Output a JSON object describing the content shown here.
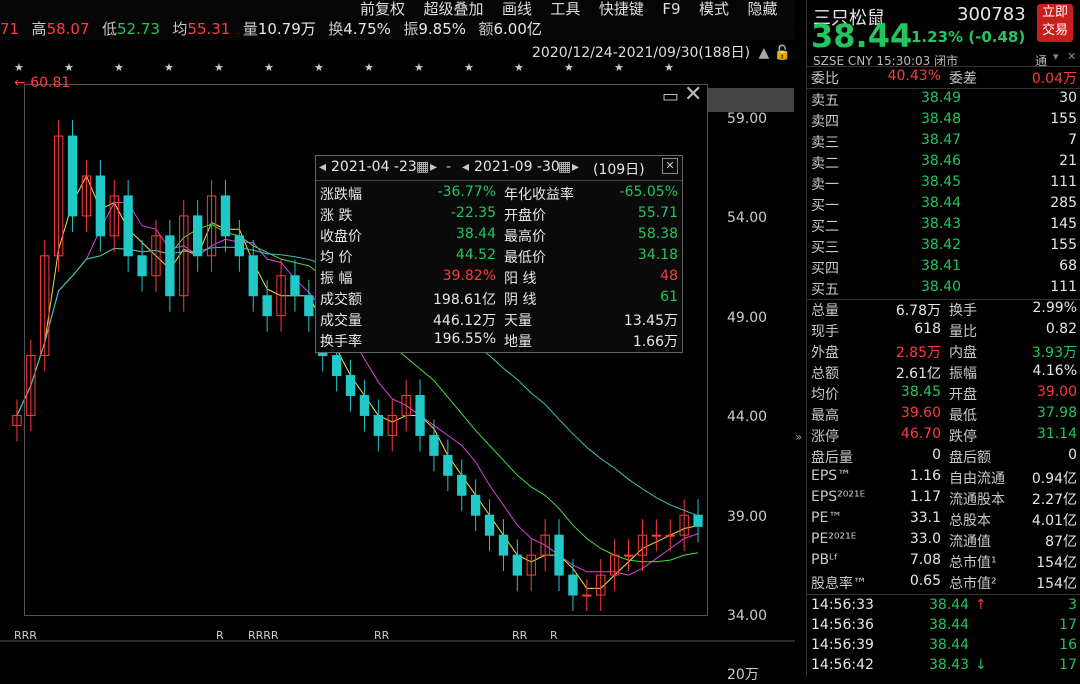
{
  "top": {
    "prev_close_partial": "71",
    "high_label": "高",
    "high": "58.07",
    "low_label": "低",
    "low": "52.73",
    "avg_label": "均",
    "avg": "55.31",
    "vol_label": "量",
    "vol": "10.79万",
    "turn_label": "换",
    "turn": "4.75%",
    "amp_label": "振",
    "amp": "9.85%",
    "amount_label": "额",
    "amount": "6.00亿",
    "menu": [
      "前复权",
      "超级叠加",
      "画线",
      "工具",
      "快捷键",
      "F9",
      "模式",
      "隐藏"
    ],
    "date_range": "2020/12/24-2021/09/30(188日)"
  },
  "chart": {
    "max_marker": "60.81",
    "yticks": [
      "59.00",
      "54.00",
      "49.00",
      "44.00",
      "39.00",
      "34.00"
    ],
    "volume_label": "20万",
    "r_markers": [
      "RRR",
      "R",
      "RRRR",
      "RR",
      "RR",
      "R"
    ]
  },
  "chart_data": {
    "type": "candlestick",
    "ylim": [
      34,
      60.81
    ],
    "close_approx": [
      44,
      47,
      52,
      58,
      54,
      56,
      53,
      55,
      52,
      51,
      53,
      50,
      54,
      52,
      55,
      53,
      52,
      50,
      49,
      51,
      50,
      49,
      47,
      46,
      45,
      44,
      43,
      44,
      45,
      43,
      42,
      41,
      40,
      39,
      38,
      37,
      36,
      37,
      38,
      36,
      35,
      35,
      36,
      37,
      37,
      38,
      38,
      38,
      39,
      38.44
    ]
  },
  "popup": {
    "start": "2021-04 -23",
    "end": "2021-09 -30",
    "days": "(109日)",
    "rows": [
      {
        "k1": "涨跌幅",
        "v1": "-36.77%",
        "k2": "年化收益率",
        "v2": "-65.05%",
        "c1": "green",
        "c2": "green"
      },
      {
        "k1": "涨  跌",
        "v1": "-22.35",
        "k2": "开盘价",
        "v2": "55.71",
        "c1": "green",
        "c2": "green"
      },
      {
        "k1": "收盘价",
        "v1": "38.44",
        "k2": "最高价",
        "v2": "58.38",
        "c1": "green",
        "c2": "green"
      },
      {
        "k1": "均  价",
        "v1": "44.52",
        "k2": "最低价",
        "v2": "34.18",
        "c1": "green",
        "c2": "green"
      },
      {
        "k1": "振  幅",
        "v1": "39.82%",
        "k2": "阳  线",
        "v2": "48",
        "c1": "red",
        "c2": "red"
      },
      {
        "k1": "成交额",
        "v1": "198.61亿",
        "k2": "阴  线",
        "v2": "61",
        "c1": "white",
        "c2": "green"
      },
      {
        "k1": "成交量",
        "v1": "446.12万",
        "k2": "天量",
        "v2": "13.45万",
        "c1": "white",
        "c2": "white"
      },
      {
        "k1": "换手率",
        "v1": "196.55%",
        "k2": "地量",
        "v2": "1.66万",
        "c1": "white",
        "c2": "white"
      }
    ]
  },
  "quote": {
    "name": "三只松鼠",
    "code": "300783",
    "buy_button": "立即交易",
    "price": "38.44",
    "change": "1.23% (-0.48)",
    "market": "SZSE",
    "currency": "CNY",
    "time": "15:30:03",
    "status": "闭市",
    "tong": "通",
    "weibi_label": "委比",
    "weibi": "40.43%",
    "weicha_label": "委差",
    "weicha": "0.04万",
    "sells": [
      {
        "label": "卖五",
        "price": "38.49",
        "vol": "30"
      },
      {
        "label": "卖四",
        "price": "38.48",
        "vol": "155"
      },
      {
        "label": "卖三",
        "price": "38.47",
        "vol": "7"
      },
      {
        "label": "卖二",
        "price": "38.46",
        "vol": "21"
      },
      {
        "label": "卖一",
        "price": "38.45",
        "vol": "111"
      }
    ],
    "buys": [
      {
        "label": "买一",
        "price": "38.44",
        "vol": "285"
      },
      {
        "label": "买二",
        "price": "38.43",
        "vol": "145"
      },
      {
        "label": "买三",
        "price": "38.42",
        "vol": "155"
      },
      {
        "label": "买四",
        "price": "38.41",
        "vol": "68"
      },
      {
        "label": "买五",
        "price": "38.40",
        "vol": "111"
      }
    ],
    "stats": [
      {
        "l1": "总量",
        "v1": "6.78万",
        "c1": "white",
        "l2": "换手",
        "v2": "2.99%",
        "c2": "white"
      },
      {
        "l1": "现手",
        "v1": "618",
        "c1": "white",
        "l2": "量比",
        "v2": "0.82",
        "c2": "white"
      },
      {
        "l1": "外盘",
        "v1": "2.85万",
        "c1": "red",
        "l2": "内盘",
        "v2": "3.93万",
        "c2": "green"
      },
      {
        "l1": "总额",
        "v1": "2.61亿",
        "c1": "white",
        "l2": "振幅",
        "v2": "4.16%",
        "c2": "white"
      },
      {
        "l1": "均价",
        "v1": "38.45",
        "c1": "green",
        "l2": "开盘",
        "v2": "39.00",
        "c2": "red"
      },
      {
        "l1": "最高",
        "v1": "39.60",
        "c1": "red",
        "l2": "最低",
        "v2": "37.98",
        "c2": "green"
      },
      {
        "l1": "涨停",
        "v1": "46.70",
        "c1": "red",
        "l2": "跌停",
        "v2": "31.14",
        "c2": "green"
      },
      {
        "l1": "盘后量",
        "v1": "0",
        "c1": "white",
        "l2": "盘后额",
        "v2": "0",
        "c2": "white"
      },
      {
        "l1": "EPS™",
        "v1": "1.16",
        "c1": "white",
        "l2": "自由流通",
        "v2": "0.94亿",
        "c2": "white"
      },
      {
        "l1": "EPS²⁰²¹ᴱ",
        "v1": "1.17",
        "c1": "white",
        "l2": "流通股本",
        "v2": "2.27亿",
        "c2": "white"
      },
      {
        "l1": "PE™",
        "v1": "33.1",
        "c1": "white",
        "l2": "总股本",
        "v2": "4.01亿",
        "c2": "white"
      },
      {
        "l1": "PE²⁰²¹ᴱ",
        "v1": "33.0",
        "c1": "white",
        "l2": "流通值",
        "v2": "87亿",
        "c2": "white"
      },
      {
        "l1": "PBᴸᶠ",
        "v1": "7.08",
        "c1": "white",
        "l2": "总市值¹",
        "v2": "154亿",
        "c2": "white"
      },
      {
        "l1": "股息率™",
        "v1": "0.65",
        "c1": "white",
        "l2": "总市值²",
        "v2": "154亿",
        "c2": "white"
      }
    ],
    "ticks": [
      {
        "time": "14:56:33",
        "price": "38.44",
        "arrow": "↑",
        "vol": "3",
        "pc": "green",
        "ac": "red",
        "vc": "green"
      },
      {
        "time": "14:56:36",
        "price": "38.44",
        "arrow": "",
        "vol": "17",
        "pc": "green",
        "ac": "",
        "vc": "green"
      },
      {
        "time": "14:56:39",
        "price": "38.44",
        "arrow": "",
        "vol": "16",
        "pc": "green",
        "ac": "",
        "vc": "green"
      },
      {
        "time": "14:56:42",
        "price": "38.43",
        "arrow": "↓",
        "vol": "17",
        "pc": "green",
        "ac": "green",
        "vc": "green"
      }
    ]
  }
}
